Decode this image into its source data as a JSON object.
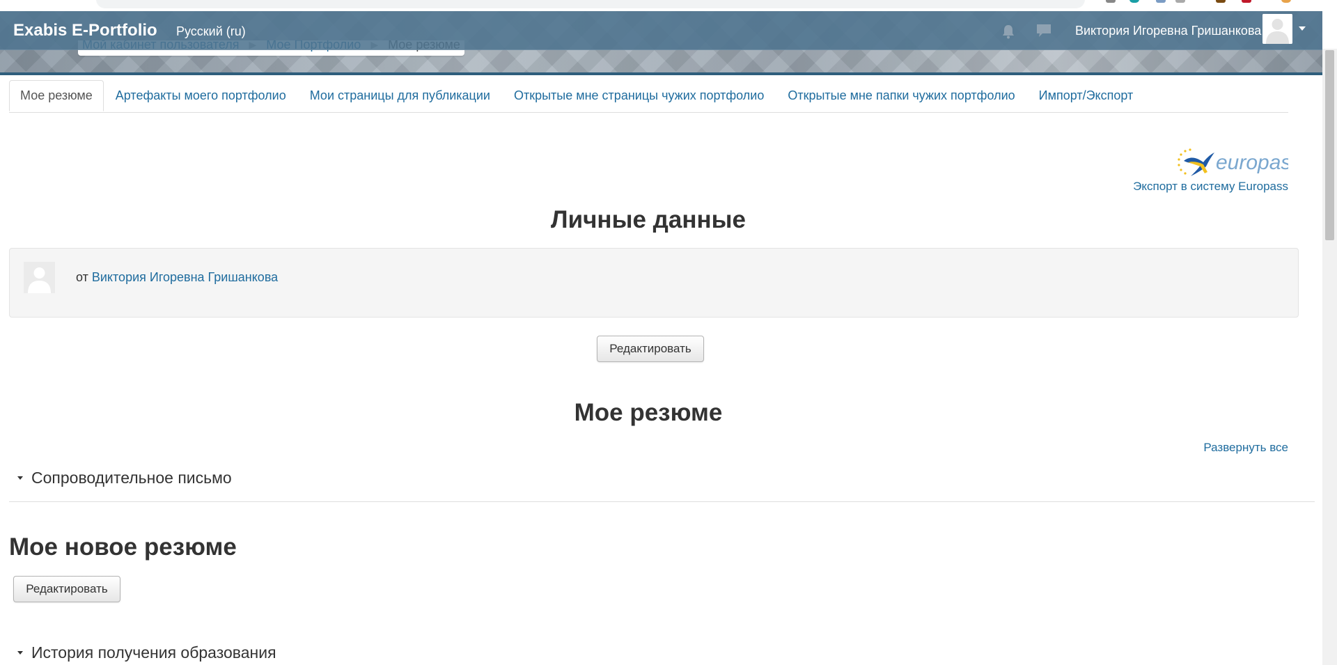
{
  "header": {
    "brand": "Exabis E-Portfolio",
    "language": "Русский (ru)",
    "user_name": "Виктория Игоревна Гришанкова",
    "icons": [
      "bell-icon",
      "chat-icon",
      "caret-down-icon"
    ]
  },
  "breadcrumb": [
    "Мой кабинет пользователя",
    "Мое Портфолио",
    "Мое резюме"
  ],
  "tabs": [
    {
      "label": "Мое резюме",
      "active": true
    },
    {
      "label": "Артефакты моего портфолио",
      "active": false
    },
    {
      "label": "Мои страницы для публикации",
      "active": false
    },
    {
      "label": "Открытые мне страницы чужих портфолио",
      "active": false
    },
    {
      "label": "Открытые мне папки чужих портфолио",
      "active": false
    },
    {
      "label": "Импорт/Экспорт",
      "active": false
    }
  ],
  "europass": {
    "logo_text": "europass",
    "export_link": "Экспорт в систему Europass"
  },
  "personal": {
    "title": "Личные данные",
    "by_prefix": "от",
    "author": "Виктория Игоревна Гришанкова",
    "edit_button": "Редактировать"
  },
  "resume": {
    "title": "Мое резюме",
    "expand_all": "Развернуть все",
    "cover_letter": "Сопроводительное письмо",
    "new_resume_title": "Мое новое резюме",
    "edit_button": "Редактировать",
    "education_history": "История получения образования"
  },
  "colors": {
    "navbar": "#4f7490",
    "link": "#1f6c9e",
    "banner_underline": "#2f5e7c"
  }
}
